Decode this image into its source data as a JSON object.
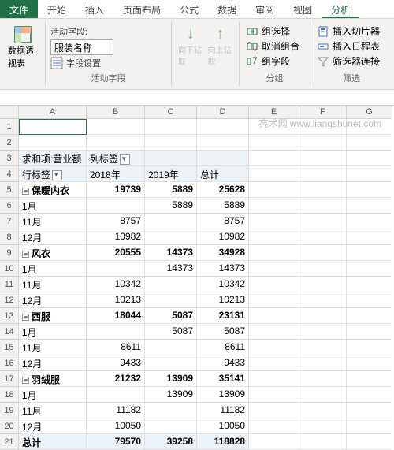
{
  "tabs": [
    "文件",
    "开始",
    "插入",
    "页面布局",
    "公式",
    "数据",
    "审阅",
    "视图",
    "分析"
  ],
  "ribbon": {
    "g1_btn": "数据透视表",
    "g1_label": "",
    "g2_active": "活动字段:",
    "g2_value": "服装名称",
    "g2_set": "字段设置",
    "g2_down": "向下钻取",
    "g2_up": "向上钻取",
    "g2_label": "活动字段",
    "g3_group": "组选择",
    "g3_ungroup": "取消组合",
    "g3_field": "组字段",
    "g3_label": "分组",
    "g4_slicer": "插入切片器",
    "g4_timeline": "插入日程表",
    "g4_filter": "筛选器连接",
    "g4_label": "筛选"
  },
  "columns": [
    "",
    "A",
    "B",
    "C",
    "D",
    "E",
    "F",
    "G"
  ],
  "watermark": "亮术网 www.liangshunet.com",
  "pivot": {
    "sum": "求和项:营业额",
    "col": "列标签",
    "row": "行标签",
    "y1": "2018年",
    "y2": "2019年",
    "total": "总计"
  },
  "rows": [
    {
      "r": "1"
    },
    {
      "r": "2"
    },
    {
      "r": "3",
      "c": [
        "求和项:营业额",
        "列标签"
      ],
      "hdr": true,
      "dd": true
    },
    {
      "r": "4",
      "c": [
        "行标签",
        "2018年",
        "2019年",
        "总计"
      ],
      "hdr": true,
      "ddRow": true
    },
    {
      "r": "5",
      "exp": true,
      "c": [
        "保暖内衣",
        "19739",
        "5889",
        "25628"
      ],
      "b": true
    },
    {
      "r": "6",
      "c": [
        "    1月",
        "",
        "5889",
        "5889"
      ]
    },
    {
      "r": "7",
      "c": [
        "    11月",
        "8757",
        "",
        "8757"
      ]
    },
    {
      "r": "8",
      "c": [
        "    12月",
        "10982",
        "",
        "10982"
      ]
    },
    {
      "r": "9",
      "exp": true,
      "c": [
        "风衣",
        "20555",
        "14373",
        "34928"
      ],
      "b": true
    },
    {
      "r": "10",
      "c": [
        "    1月",
        "",
        "14373",
        "14373"
      ]
    },
    {
      "r": "11",
      "c": [
        "    11月",
        "10342",
        "",
        "10342"
      ]
    },
    {
      "r": "12",
      "c": [
        "    12月",
        "10213",
        "",
        "10213"
      ]
    },
    {
      "r": "13",
      "exp": true,
      "c": [
        "西服",
        "18044",
        "5087",
        "23131"
      ],
      "b": true
    },
    {
      "r": "14",
      "c": [
        "    1月",
        "",
        "5087",
        "5087"
      ]
    },
    {
      "r": "15",
      "c": [
        "    11月",
        "8611",
        "",
        "8611"
      ]
    },
    {
      "r": "16",
      "c": [
        "    12月",
        "9433",
        "",
        "9433"
      ]
    },
    {
      "r": "17",
      "exp": true,
      "c": [
        "羽绒服",
        "21232",
        "13909",
        "35141"
      ],
      "b": true
    },
    {
      "r": "18",
      "c": [
        "    1月",
        "",
        "13909",
        "13909"
      ]
    },
    {
      "r": "19",
      "c": [
        "    11月",
        "11182",
        "",
        "11182"
      ]
    },
    {
      "r": "20",
      "c": [
        "    12月",
        "10050",
        "",
        "10050"
      ]
    },
    {
      "r": "21",
      "c": [
        "总计",
        "79570",
        "39258",
        "118828"
      ],
      "b": true,
      "hdr": true
    }
  ]
}
